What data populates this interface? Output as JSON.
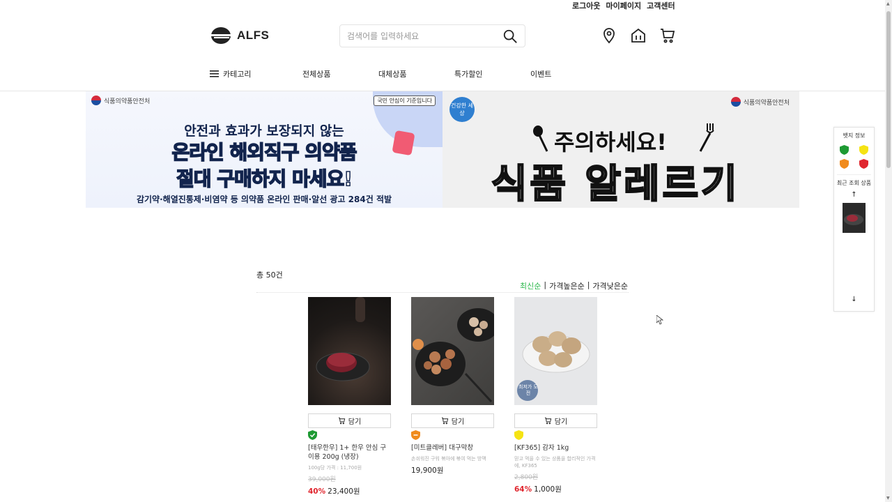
{
  "top_links": [
    "로그아웃",
    "마이페이지",
    "고객센터"
  ],
  "logo": {
    "name": "ALFS"
  },
  "search": {
    "placeholder": "검색어를 입력하세요"
  },
  "header_icons": [
    "location-pin-icon",
    "store-icon",
    "cart-icon"
  ],
  "gnb": {
    "category": "카테고리",
    "items": [
      "전체상품",
      "대체상품",
      "특가할인",
      "이벤트"
    ]
  },
  "banner_left": {
    "agency": "식품의약품안전처",
    "stamp": "국민 안심이 기준입니다",
    "line1": "안전과 효과가 보장되지 않는",
    "line2_a": "온라인 ",
    "line2_b": "해외직구 의약품",
    "line3_a": "절대",
    "line3_b": " 구매하지 마세요!",
    "line4": "감기약·해열진통제·비염약 등 의약품 온라인 판매·알선 광고 284건 적발"
  },
  "banner_right": {
    "agency": "식품의약품안전처",
    "badge": "건강한 세상",
    "title1": "주의하세요!",
    "title2": "식품 알레르기"
  },
  "listing": {
    "total": "총 50건",
    "sort": [
      "최신순",
      "|",
      "가격높은순",
      "|",
      "가격낮은순"
    ]
  },
  "cart_label": "담기",
  "products": [
    {
      "title": "[태우한우] 1+ 한우 안심 구이용 200g (냉장)",
      "desc": "100g당 가격 : 11,700원",
      "original": "39,000원",
      "rate": "40%",
      "price": "23,400원",
      "badge_color": "#1e9a33"
    },
    {
      "title": "[미트클레버] 대구막창",
      "desc": "손쉬워진 구워 볶아에 볶여 먹는 방맥",
      "original": "",
      "rate": "",
      "price": "19,900원",
      "badge_color": "#f08b1d"
    },
    {
      "title": "[KF365] 감자 1kg",
      "desc": "믿고 먹을 수 있는 상품을 합리적인 가격에, KF365",
      "original": "2,800원",
      "rate": "64%",
      "price": "1,000원",
      "badge_color": "#f5e313",
      "img_label": "최저가 도전"
    }
  ],
  "side_panel": {
    "badge_info": "뱃지 정보",
    "badge_colors": [
      "#1e9a33",
      "#f5e313",
      "#f08b1d",
      "#e0272f"
    ],
    "recent": "최근 조회 상품",
    "up": "↑",
    "down": "↓"
  }
}
